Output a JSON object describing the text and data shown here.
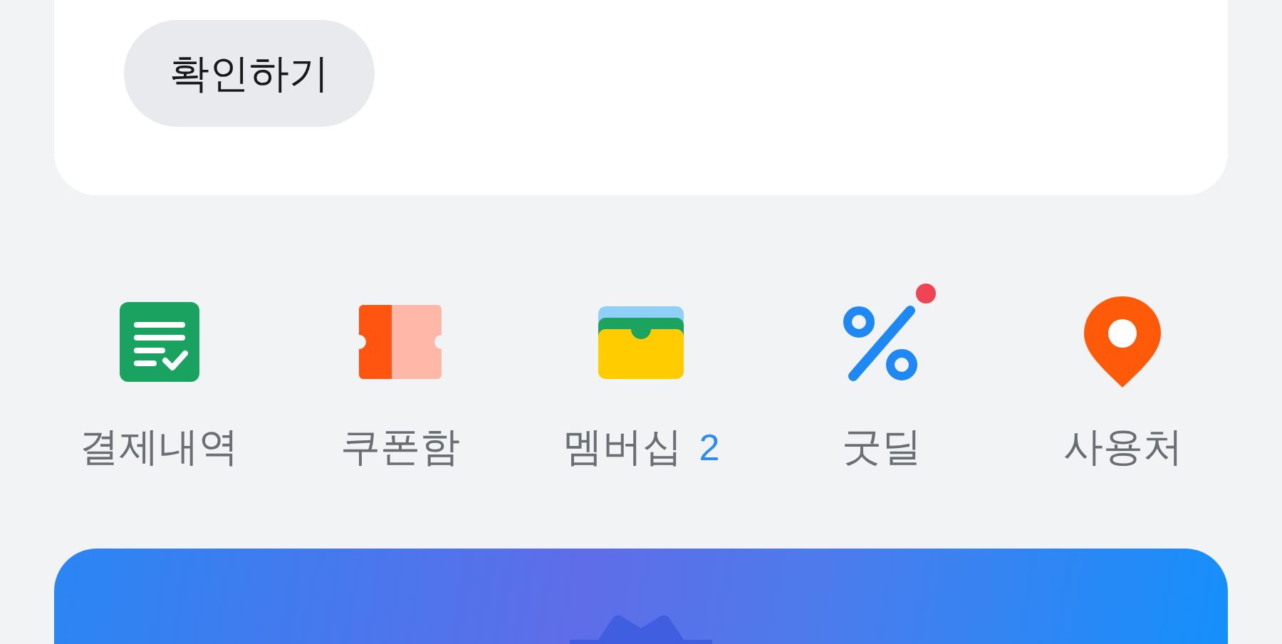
{
  "confirm_button": {
    "label": "확인하기"
  },
  "shortcuts": [
    {
      "kind": "receipt",
      "label": "결제내역",
      "new_dot": false
    },
    {
      "kind": "coupon",
      "label": "쿠폰함",
      "new_dot": false
    },
    {
      "kind": "wallet",
      "label": "멤버십",
      "count": "2",
      "new_dot": false
    },
    {
      "kind": "percent",
      "label": "굿딜",
      "new_dot": true
    },
    {
      "kind": "pin",
      "label": "사용처",
      "new_dot": false
    }
  ]
}
